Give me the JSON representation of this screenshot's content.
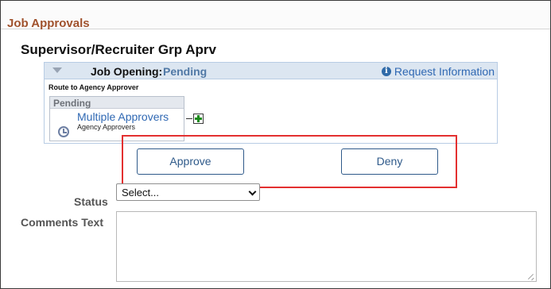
{
  "section": {
    "title": "Job Approvals"
  },
  "group": {
    "title": "Supervisor/Recruiter Grp Aprv"
  },
  "opening": {
    "label": "Job Opening:",
    "status": "Pending",
    "request_info_label": "Request Information",
    "route_label": "Route to Agency Approver",
    "step": {
      "header": "Pending",
      "approver_link": "Multiple Approvers",
      "approver_sub": "Agency Approvers"
    }
  },
  "actions": {
    "approve_label": "Approve",
    "deny_label": "Deny"
  },
  "form": {
    "status_label": "Status",
    "status_value": "Select...",
    "comments_label": "Comments Text",
    "comments_value": ""
  },
  "colors": {
    "section_title": "#a0522d",
    "link": "#2f68b3",
    "highlight": "#e33030",
    "bar_bg": "#dce6f1"
  },
  "icons": [
    "collapse-triangle-icon",
    "info-icon",
    "clock-icon",
    "add-approver-icon",
    "chevron-down-icon",
    "resize-grip-icon"
  ]
}
